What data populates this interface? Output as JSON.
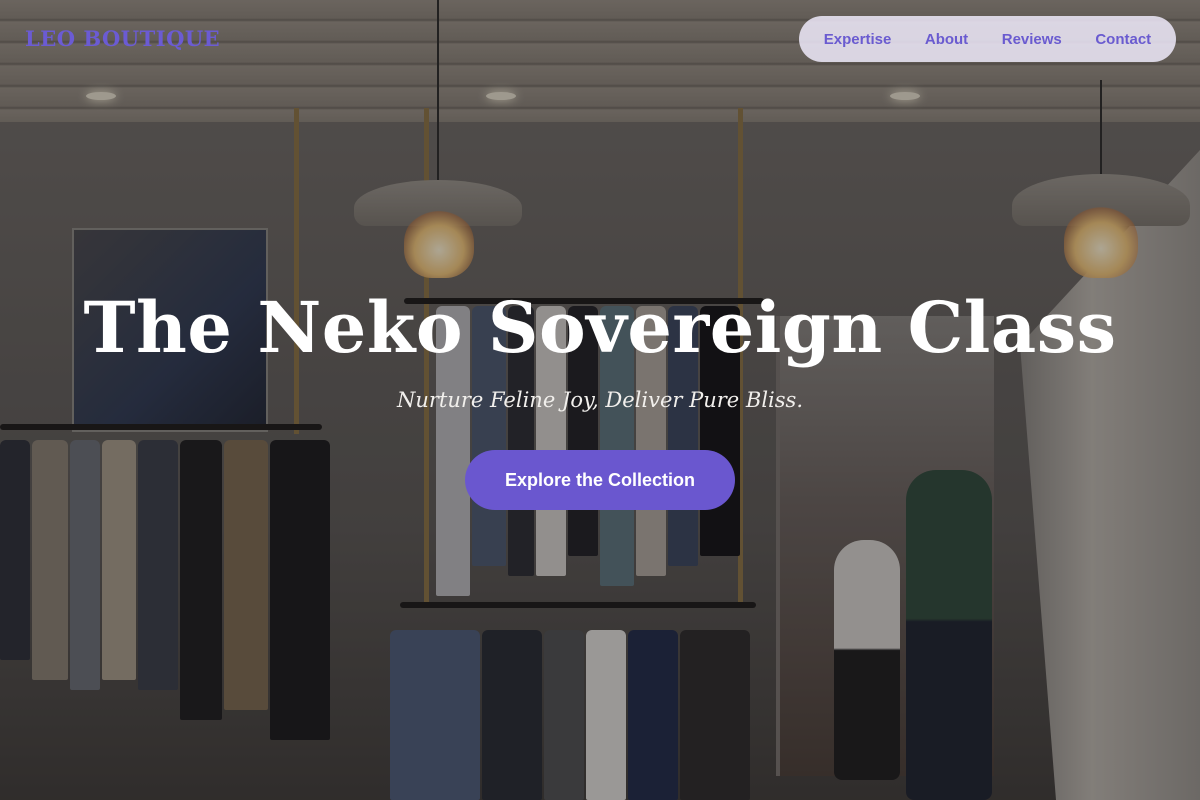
{
  "brand": {
    "logo_text": "LEO BOUTIQUE",
    "accent_color": "#6a57cf"
  },
  "nav": {
    "items": [
      {
        "label": "Expertise"
      },
      {
        "label": "About"
      },
      {
        "label": "Reviews"
      },
      {
        "label": "Contact"
      }
    ]
  },
  "hero": {
    "title": "The Neko Sovereign Class",
    "subtitle": "Nurture Feline Joy, Deliver Pure Bliss.",
    "cta_label": "Explore the Collection",
    "background": "boutique-interior-photo"
  }
}
